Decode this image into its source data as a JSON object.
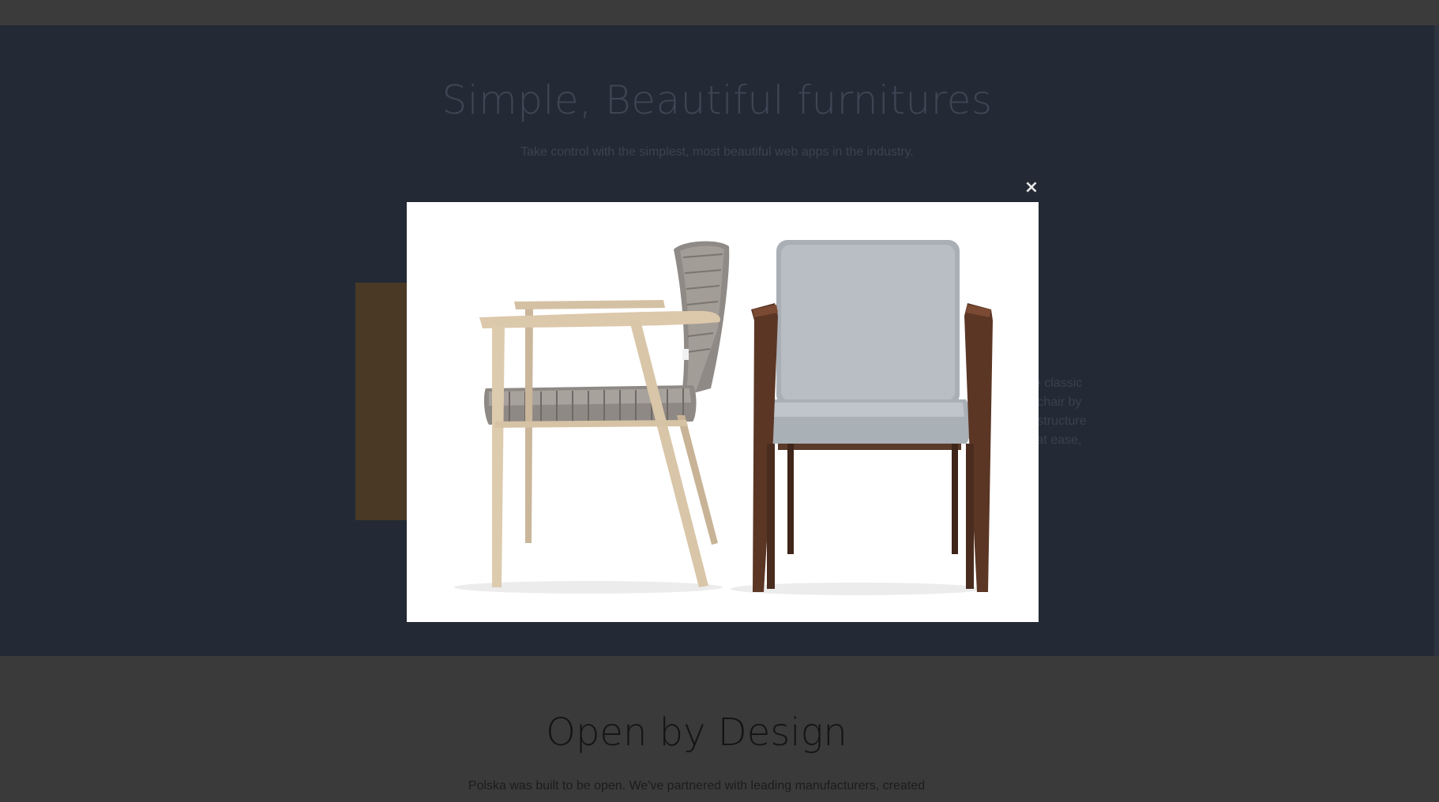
{
  "hero": {
    "title": "Simple, Beautiful furnitures",
    "subtitle": "Take control with the simplest, most beautiful web apps in the industry."
  },
  "feature": {
    "text_lines": [
      "he classic",
      "n chair by",
      "n structure",
      "y at ease,"
    ]
  },
  "section": {
    "title": "Open by Design",
    "body": "Polska was built to be open. We've partnered with leading manufacturers, created"
  },
  "lightbox": {
    "close_label": "×",
    "image_alt": "Two upholstered armchairs, one light wood and one dark wood"
  }
}
